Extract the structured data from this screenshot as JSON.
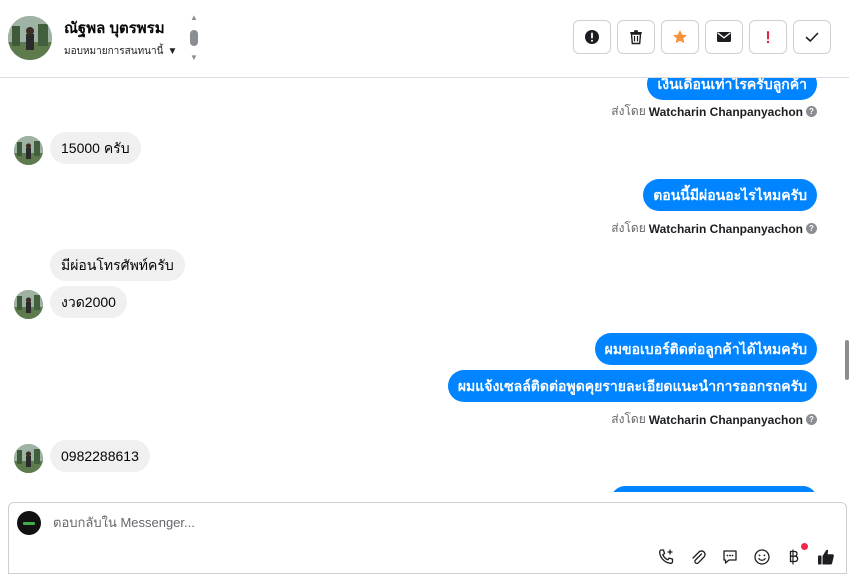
{
  "header": {
    "contact_name": "ณัฐพล บุตรพรม",
    "assign_label": "มอบหมายการสนทนานี้"
  },
  "actions": [
    {
      "name": "spam-button",
      "icon": "alert-circle-icon"
    },
    {
      "name": "delete-button",
      "icon": "trash-icon"
    },
    {
      "name": "star-button",
      "icon": "star-icon"
    },
    {
      "name": "mark-unread-button",
      "icon": "envelope-icon"
    },
    {
      "name": "follow-up-button",
      "icon": "exclamation-icon"
    },
    {
      "name": "done-button",
      "icon": "checkmark-icon"
    }
  ],
  "messages": [
    {
      "direction": "out",
      "text": "เงินเดือนเท่าไรครับลูกค้า"
    },
    {
      "direction": "sent_by",
      "prefix": "ส่งโดย",
      "name": "Watcharin Chanpanyachon"
    },
    {
      "direction": "in",
      "text": "15000 ครับ"
    },
    {
      "direction": "out",
      "text": "ตอนนี้มีผ่อนอะไรไหมครับ"
    },
    {
      "direction": "sent_by",
      "prefix": "ส่งโดย",
      "name": "Watcharin Chanpanyachon"
    },
    {
      "direction": "in",
      "text": "มีผ่อนโทรศัพท์ครับ"
    },
    {
      "direction": "in",
      "text": "งวด2000"
    },
    {
      "direction": "out",
      "text": "ผมขอเบอร์ติดต่อลูกค้าได้ไหมครับ"
    },
    {
      "direction": "out",
      "text": "ผมแจ้งเซลล์ติดต่อพูดคุยรายละเอียดแนะนำการออกรถครับ"
    },
    {
      "direction": "sent_by",
      "prefix": "ส่งโดย",
      "name": "Watcharin Chanpanyachon"
    },
    {
      "direction": "in",
      "text": "0982288613"
    }
  ],
  "composer": {
    "placeholder": "ตอบกลับใน Messenger...",
    "tools": [
      "phone-add-icon",
      "paperclip-icon",
      "saved-reply-icon",
      "emoji-icon",
      "baht-icon",
      "thumbs-up-icon"
    ]
  },
  "colors": {
    "outgoing_bubble": "#0084ff",
    "incoming_bubble": "#f0f0f0",
    "star": "#f7923b",
    "alert": "#e41e3f",
    "notification_dot": "#f0284a"
  }
}
